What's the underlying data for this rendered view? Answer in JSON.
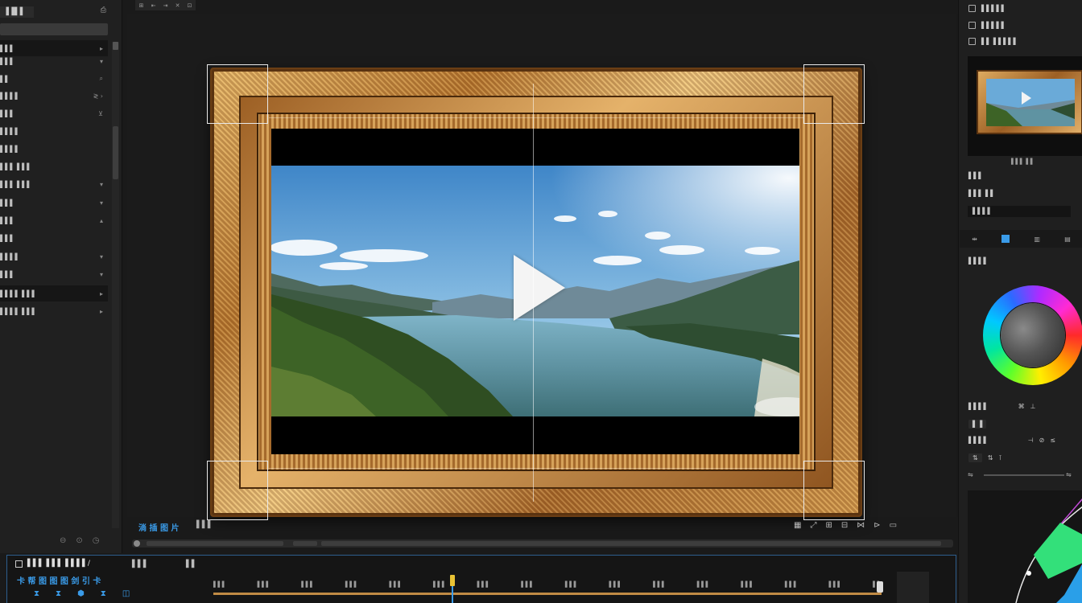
{
  "left_panel": {
    "tab": "▐▐▌▌",
    "tab_icon": "⎙",
    "items": [
      {
        "label": "▌▌▌",
        "arrow": "▸",
        "highlight": true
      },
      {
        "label": "▌▌▌",
        "arrow": "▾"
      },
      {
        "label": "▌▌",
        "arrow": "⌕"
      },
      {
        "label": "▌▌▌▌",
        "arrow": "≷ ›"
      },
      {
        "label": "▌▌▌",
        "arrow": "⊻"
      },
      {
        "label": "▌▌▌▌",
        "arrow": ""
      },
      {
        "label": "▌▌▌▌",
        "arrow": ""
      },
      {
        "label": "▌▌▌ ▌▌▌",
        "arrow": ""
      },
      {
        "label": "▌▌▌ ▌▌▌",
        "arrow": "▾"
      },
      {
        "label": "▌▌▌",
        "arrow": "▾"
      },
      {
        "label": "▌▌▌",
        "arrow": "▴"
      },
      {
        "label": "▌▌▌",
        "arrow": ""
      },
      {
        "label": "▌▌▌▌",
        "arrow": "▾"
      },
      {
        "label": "▌▌▌",
        "arrow": "▾"
      },
      {
        "label": "▌▌▌▌ ▌▌▌",
        "arrow": "▸",
        "highlight": true
      },
      {
        "label": "▌▌▌▌ ▌▌▌",
        "arrow": "▸"
      }
    ],
    "bottom_icons": [
      "⊖",
      "⊙",
      "◷"
    ]
  },
  "top_toolbar": [
    "⊞",
    "⇤",
    "⇥",
    "✕",
    "⊡"
  ],
  "viewer": {
    "label": "淌 插 图 片",
    "label2": "▌▌▌",
    "tools": [
      "▦",
      "⤢",
      "⊞",
      "⊟",
      "⋈",
      "⊳",
      "▭"
    ]
  },
  "timeline": {
    "title": "▌▌▌ ▌▌▌ ▌▌▌▌/",
    "tab2": "▌▌▌",
    "tab3": "▌▌",
    "subtitle": "卡 帮 图 图 图 剑 引 卡",
    "buttons": [
      "⧗",
      "⧗",
      "⬢",
      "⧗",
      "◫"
    ],
    "ruler": [
      "▌▌▌",
      "▌▌▌",
      "▌▌▌",
      "▌▌▌",
      "▌▌▌",
      "▌▌▌",
      "▌▌▌",
      "▌▌▌",
      "▌▌▌",
      "▌▌▌",
      "▌▌▌",
      "▌▌▌",
      "▌▌▌",
      "▌▌▌",
      "▌▌▌",
      "▌▌"
    ]
  },
  "right_panel": {
    "row1": "▌▌▌▌▌",
    "row2": "▌▌▌▌▌",
    "row3": "▌▌ ▌▌▌▌▌",
    "preview_sub": "▌▌▌ ▌▌",
    "section1": "▌▌▌",
    "section1_row": "▌▌▌ ▌▌",
    "input_value": "▌▌▌▌",
    "toolbar": [
      "⇹",
      "■",
      "▥",
      "▤"
    ],
    "section2": "▌▌▌▌",
    "section3": "▌▌▌▌",
    "section3_icons": [
      "⌘",
      "⊥"
    ],
    "section4": "▌▌▌▌",
    "section4_icons": [
      "⊣",
      "⊘",
      "≤"
    ],
    "tool_row": [
      "⇅",
      "⇅",
      "⊺"
    ],
    "slider_icons": [
      "⇋",
      "⇋"
    ]
  },
  "colors": {
    "accent": "#3a9be8",
    "frame_gold": "#d49a4e",
    "playhead": "#e8c234"
  }
}
